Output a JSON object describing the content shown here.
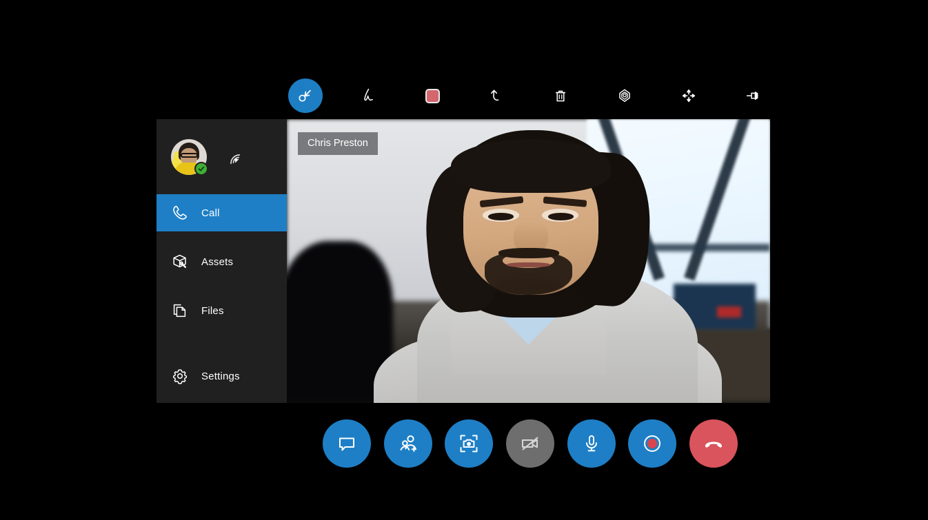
{
  "app": {
    "background_color": "#000000",
    "accent_color": "#1e7fc6",
    "danger_color": "#d9545c",
    "sidebar_color": "#202020"
  },
  "annotation_toolbar": {
    "tools": [
      {
        "name": "select-tool",
        "label": "Select",
        "icon": "cursor-select-icon",
        "active": true
      },
      {
        "name": "draw-tool",
        "label": "Draw",
        "icon": "pen-icon",
        "active": false
      },
      {
        "name": "color-swatch",
        "label": "Color",
        "icon": "color-swatch-icon",
        "active": false,
        "color": "#d4666e"
      },
      {
        "name": "undo-tool",
        "label": "Undo",
        "icon": "undo-icon",
        "active": false
      },
      {
        "name": "delete-tool",
        "label": "Delete",
        "icon": "trash-icon",
        "active": false
      },
      {
        "name": "marker-tool",
        "label": "Place marker",
        "icon": "location-marker-icon",
        "active": false
      },
      {
        "name": "move-tool",
        "label": "Move",
        "icon": "move-arrows-icon",
        "active": false
      },
      {
        "name": "pin-tool",
        "label": "Pin",
        "icon": "pushpin-icon",
        "active": false
      }
    ]
  },
  "sidebar": {
    "profile": {
      "avatar_name": "user-avatar",
      "presence": "available",
      "presence_color": "#3faf35",
      "signal_icon": "wifi-signal-icon"
    },
    "items": [
      {
        "label": "Call",
        "icon": "phone-icon",
        "active": true
      },
      {
        "label": "Assets",
        "icon": "box-icon",
        "active": false
      },
      {
        "label": "Files",
        "icon": "files-icon",
        "active": false
      },
      {
        "label": "Settings",
        "icon": "gear-icon",
        "active": false
      }
    ]
  },
  "video": {
    "participant_name": "Chris Preston"
  },
  "call_controls": [
    {
      "name": "chat-button",
      "label": "Chat",
      "icon": "chat-bubble-icon",
      "style": "blue"
    },
    {
      "name": "add-person-button",
      "label": "Add participant",
      "icon": "add-person-icon",
      "style": "blue"
    },
    {
      "name": "snapshot-button",
      "label": "Snapshot",
      "icon": "camera-icon",
      "style": "blue"
    },
    {
      "name": "video-toggle-button",
      "label": "Video off",
      "icon": "video-off-icon",
      "style": "grey"
    },
    {
      "name": "mic-toggle-button",
      "label": "Microphone",
      "icon": "microphone-icon",
      "style": "blue"
    },
    {
      "name": "record-button",
      "label": "Record",
      "icon": "record-icon",
      "style": "blue"
    },
    {
      "name": "end-call-button",
      "label": "End call",
      "icon": "hang-up-icon",
      "style": "red"
    }
  ]
}
